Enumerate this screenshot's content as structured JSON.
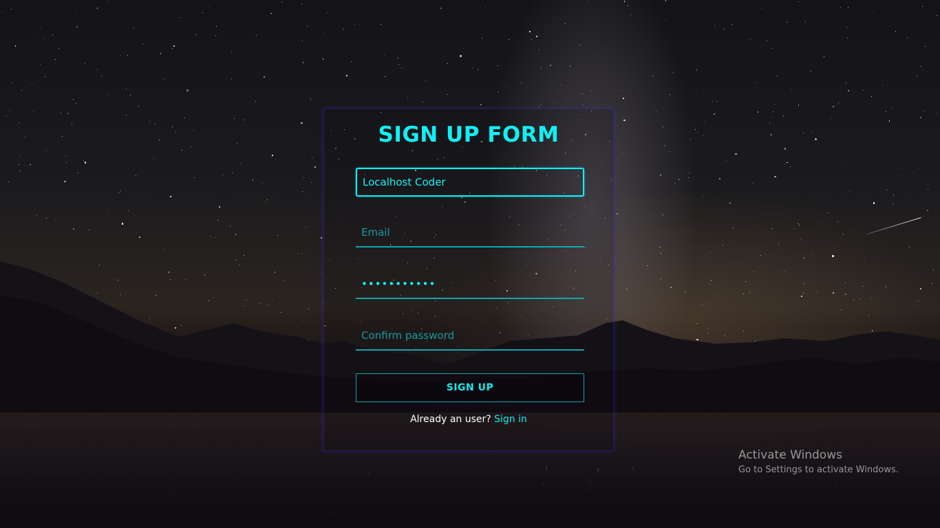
{
  "form": {
    "title": "SIGN UP FORM",
    "name_value": "Localhost Coder",
    "email_placeholder": "Email",
    "password_value": "password123",
    "confirm_placeholder": "Confirm password",
    "submit_label": "SIGN UP",
    "signin_prompt": "Already an user?",
    "signin_link": "Sign in"
  },
  "watermark": {
    "title": "Activate Windows",
    "subtitle": "Go to Settings to activate Windows."
  },
  "colors": {
    "accent": "#0ff0f4",
    "underline": "#11a7ad",
    "panel_glow": "#3c28b4"
  }
}
